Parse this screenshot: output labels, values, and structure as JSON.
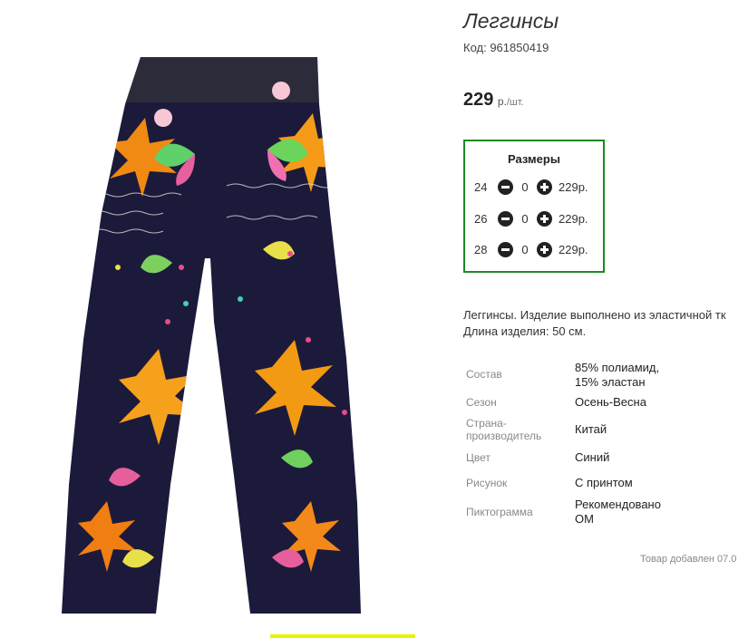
{
  "product": {
    "title": "Леггинсы",
    "code": "Код: 961850419",
    "price": "229",
    "price_currency": "р.",
    "price_per": "/шт."
  },
  "sizes": {
    "title": "Размеры",
    "rows": [
      {
        "size": "24",
        "qty": "0",
        "price": "229р."
      },
      {
        "size": "26",
        "qty": "0",
        "price": "229р."
      },
      {
        "size": "28",
        "qty": "0",
        "price": "229р."
      }
    ]
  },
  "description": {
    "line1": "Леггинсы. Изделие выполнено из эластичной тк",
    "line2": "Длина изделия: 50 см."
  },
  "attributes": [
    {
      "name": "Состав",
      "value": "85% полиамид,\n15% эластан"
    },
    {
      "name": "Сезон",
      "value": "Осень-Весна"
    },
    {
      "name": "Страна-\nпроизводитель",
      "value": "Китай"
    },
    {
      "name": "Цвет",
      "value": "Синий"
    },
    {
      "name": "Рисунок",
      "value": "С принтом"
    },
    {
      "name": "Пиктограмма",
      "value": "Рекомендовано\nОМ"
    }
  ],
  "added_note": "Товар добавлен 07.0",
  "colors": {
    "accent_border": "#1d8a22",
    "pants_base": "#1c1a3a",
    "strip": "#e8f200"
  },
  "icons": {
    "minus": "minus-circle-icon",
    "plus": "plus-circle-icon"
  }
}
